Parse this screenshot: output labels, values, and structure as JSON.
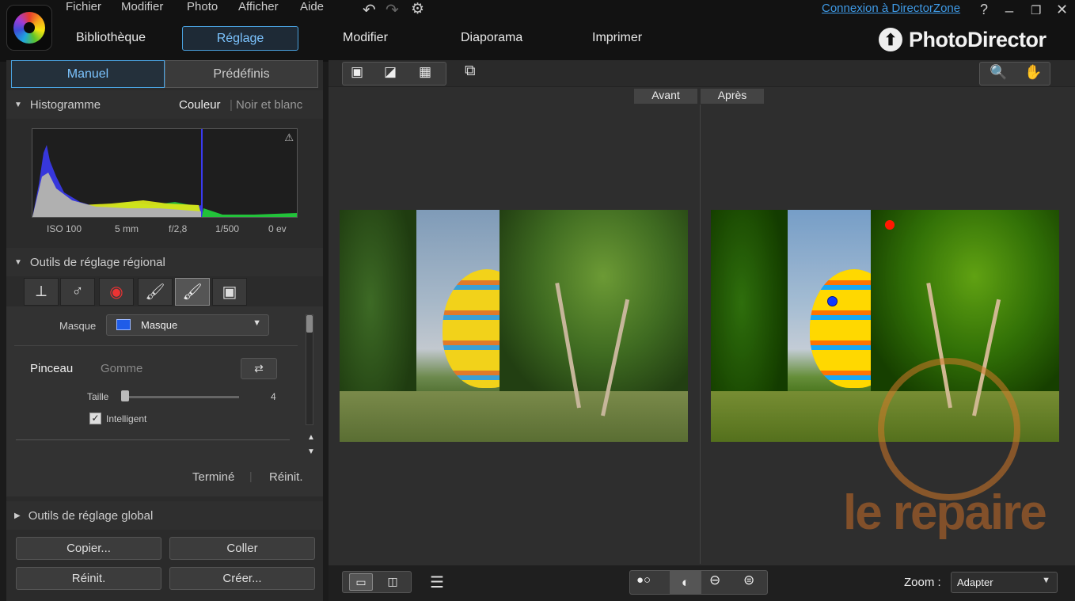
{
  "menu": {
    "items": [
      "Fichier",
      "Modifier",
      "Photo",
      "Afficher",
      "Aide"
    ]
  },
  "topright": {
    "link": "Connexion à DirectorZone",
    "help": "?"
  },
  "nav": {
    "items": [
      "Bibliothèque",
      "Réglage",
      "Modifier",
      "Diaporama",
      "Imprimer"
    ],
    "active": "Réglage"
  },
  "brand": {
    "name": "PhotoDirector"
  },
  "panel": {
    "tabs": [
      "Manuel",
      "Prédéfinis"
    ],
    "histogram": {
      "title": "Histogramme",
      "mode_color": "Couleur",
      "mode_bw": "Noir et blanc",
      "exif": [
        "ISO 100",
        "5 mm",
        "f/2,8",
        "1/500",
        "0 ev"
      ]
    },
    "regional": {
      "title": "Outils de réglage régional",
      "mask_label": "Masque",
      "mask_value": "Masque",
      "brush": "Pinceau",
      "eraser": "Gomme",
      "size_label": "Taille",
      "size_value": "4",
      "smart_label": "Intelligent",
      "done": "Terminé",
      "reset": "Réinit."
    },
    "global": {
      "title": "Outils de réglage global"
    },
    "buttons": {
      "copy": "Copier...",
      "paste": "Coller",
      "reset": "Réinit.",
      "create": "Créer..."
    }
  },
  "viewer": {
    "before": "Avant",
    "after": "Après",
    "zoom_label": "Zoom :",
    "zoom_value": "Adapter"
  },
  "watermark": {
    "text": "le repaire"
  },
  "colors": {
    "accent": "#4aa2e0",
    "link": "#3f9ae6",
    "mask_swatch": "#1f5ce8"
  }
}
